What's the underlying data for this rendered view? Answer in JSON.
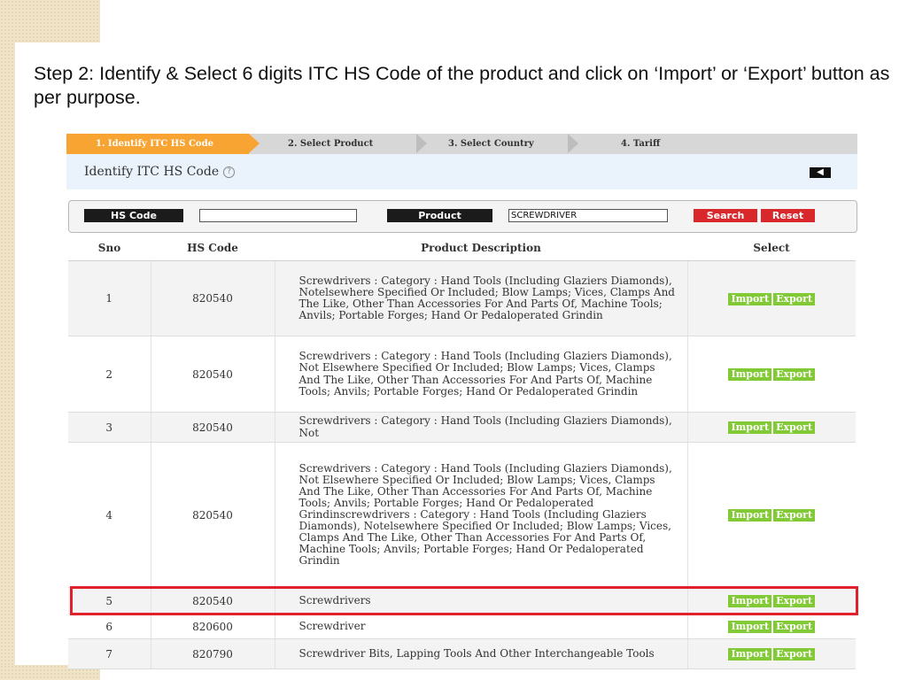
{
  "slide": {
    "title": "Step 2: Identify & Select 6 digits ITC HS Code of the product and click on ‘Import’ or ‘Export’ button as per purpose."
  },
  "wizard": {
    "steps": [
      {
        "label": "1. Identify ITC HS Code",
        "active": true
      },
      {
        "label": "2. Select Product",
        "active": false
      },
      {
        "label": "3. Select Country",
        "active": false
      },
      {
        "label": "4. Tariff",
        "active": false
      }
    ]
  },
  "panel": {
    "title": "Identify ITC HS Code",
    "help_glyph": "?",
    "back_glyph": "◀"
  },
  "search": {
    "hs_code_label": "HS Code",
    "hs_code_value": "",
    "product_label": "Product",
    "product_value": "SCREWDRIVER",
    "search_label": "Search",
    "reset_label": "Reset"
  },
  "table": {
    "headers": [
      "Sno",
      "HS Code",
      "Product Description",
      "Select"
    ],
    "import_label": "Import",
    "export_label": "Export",
    "rows": [
      {
        "sno": "1",
        "code": "820540",
        "desc": "Screwdrivers : Category : Hand Tools (Including Glaziers Diamonds), Notelsewhere Specified Or Included; Blow Lamps; Vices, Clamps And The Like, Other Than Accessories For And Parts Of, Machine Tools; Anvils; Portable Forges; Hand Or Pedaloperated Grindin"
      },
      {
        "sno": "2",
        "code": "820540",
        "desc": "Screwdrivers : Category : Hand Tools (Including Glaziers Diamonds), Not Elsewhere Specified Or Included; Blow Lamps; Vices, Clamps And The Like, Other Than Accessories For And Parts Of, Machine Tools; Anvils; Portable Forges; Hand Or Pedaloperated Grindin"
      },
      {
        "sno": "3",
        "code": "820540",
        "desc": "Screwdrivers : Category : Hand Tools (Including Glaziers Diamonds), Not"
      },
      {
        "sno": "4",
        "code": "820540",
        "desc": "Screwdrivers : Category : Hand Tools (Including Glaziers Diamonds), Not Elsewhere Specified Or Included; Blow Lamps; Vices, Clamps And The Like, Other Than Accessories For And Parts Of, Machine Tools; Anvils; Portable Forges; Hand Or Pedaloperated Grindinscrewdrivers : Category : Hand Tools (Including Glaziers Diamonds), Notelsewhere Specified Or Included; Blow Lamps; Vices, Clamps And The Like, Other Than Accessories For And Parts Of, Machine Tools; Anvils; Portable Forges; Hand Or Pedaloperated Grindin"
      },
      {
        "sno": "5",
        "code": "820540",
        "desc": "Screwdrivers"
      },
      {
        "sno": "6",
        "code": "820600",
        "desc": "Screwdriver"
      },
      {
        "sno": "7",
        "code": "820790",
        "desc": "Screwdriver Bits, Lapping Tools And Other Interchangeable Tools"
      }
    ]
  },
  "colors": {
    "active_step": "#f8a433",
    "select_button": "#82c936",
    "action_button": "#d8282b",
    "highlight": "#e0202a"
  }
}
